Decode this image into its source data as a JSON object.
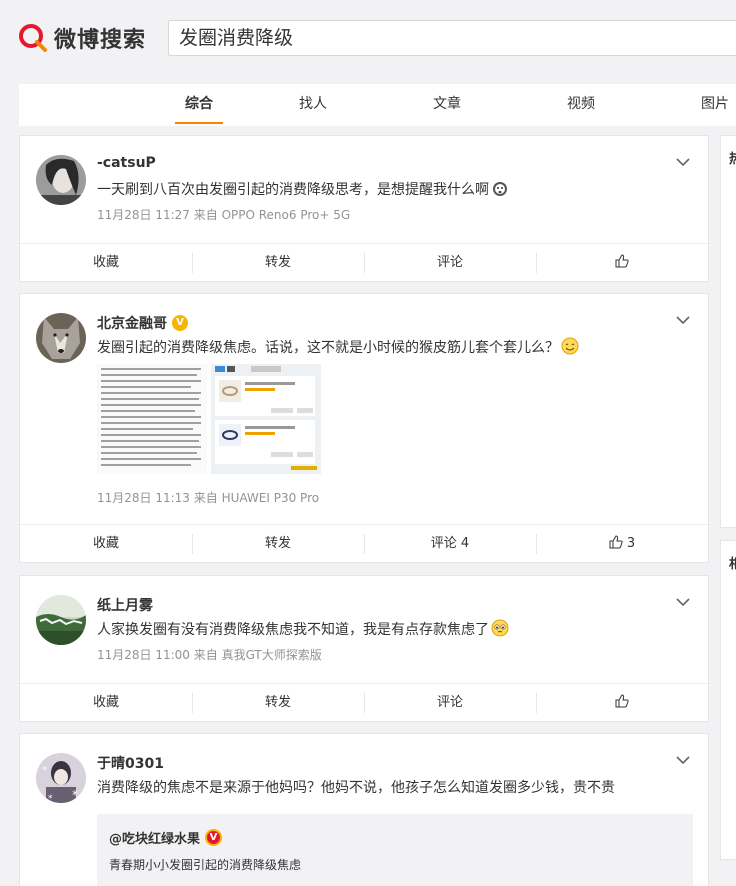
{
  "header": {
    "logo_text": "微博搜索",
    "search_value": "发圈消费降级"
  },
  "tabs": [
    {
      "label": "综合",
      "active": true
    },
    {
      "label": "找人"
    },
    {
      "label": "文章"
    },
    {
      "label": "视频"
    },
    {
      "label": "图片"
    }
  ],
  "posts": [
    {
      "user": "-catsuP",
      "text": "一天刷到八百次由发圈引起的消费降级思考，是想提醒我什么啊",
      "meta": "11月28日 11:27  来自 OPPO Reno6 Pro+ 5G",
      "actions": {
        "fav": "收藏",
        "repost": "转发",
        "comment": "评论",
        "like": ""
      }
    },
    {
      "user": "北京金融哥",
      "text": "发圈引起的消费降级焦虑。话说，这不就是小时候的猴皮筋儿套个套儿么？",
      "meta": "11月28日 11:13  来自 HUAWEI P30 Pro",
      "actions": {
        "fav": "收藏",
        "repost": "转发",
        "comment": "评论 4",
        "like": "3"
      }
    },
    {
      "user": "纸上月雾",
      "text": "人家换发圈有没有消费降级焦虑我不知道，我是有点存款焦虑了",
      "meta": "11月28日 11:00  来自 真我GT大师探索版",
      "actions": {
        "fav": "收藏",
        "repost": "转发",
        "comment": "评论",
        "like": ""
      }
    },
    {
      "user": "于晴0301",
      "text": "消费降级的焦虑不是来源于他妈吗？他妈不说，他孩子怎么知道发圈多少钱，贵不贵",
      "repost_user": "@吃块红绿水果",
      "repost_text": "青春期小小发圈引起的消费降级焦虑"
    }
  ],
  "side_labels": [
    "热",
    "相"
  ],
  "colors": {
    "accent": "#ff8200",
    "badge": "#f7b500",
    "logo_red": "#e6162d"
  }
}
